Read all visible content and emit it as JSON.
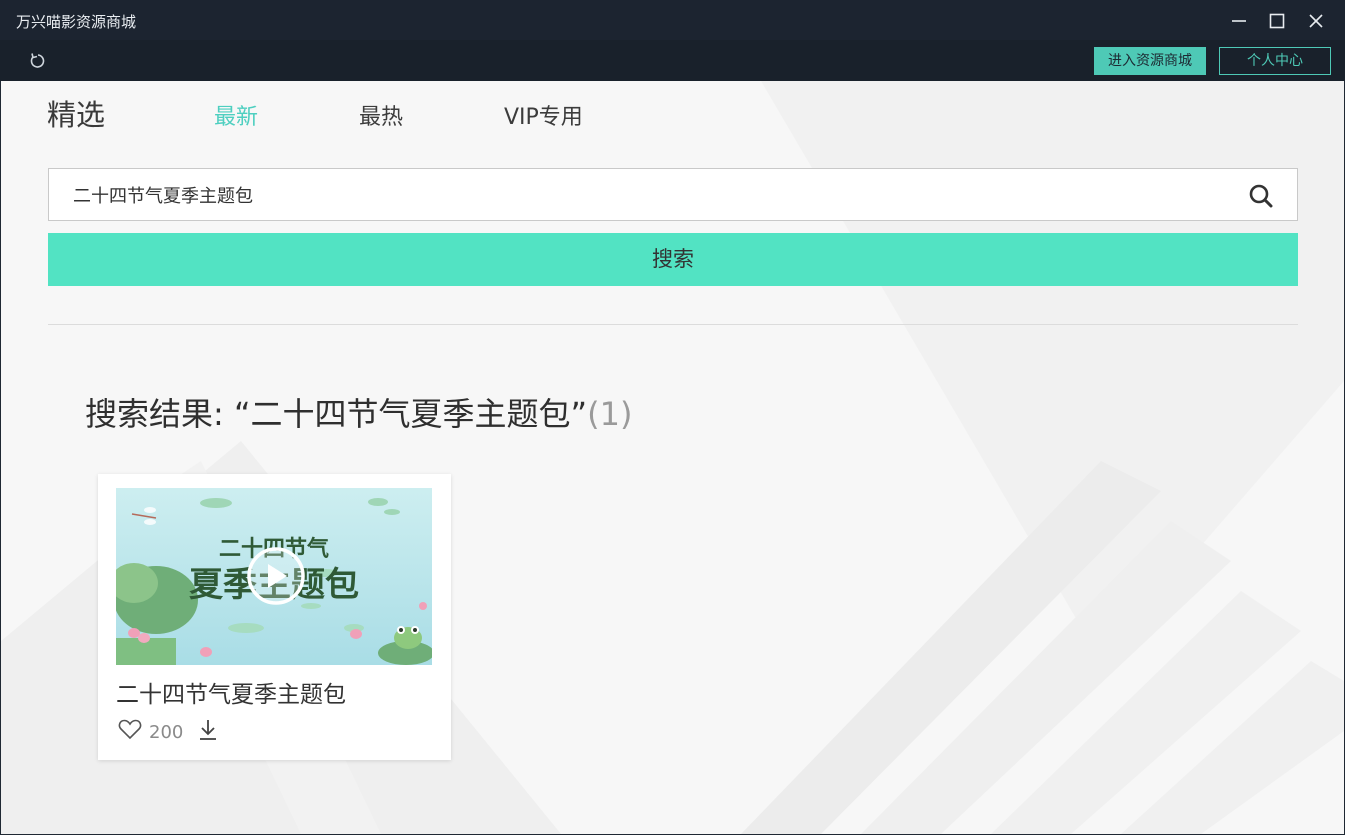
{
  "window": {
    "title": "万兴喵影资源商城"
  },
  "toolbar": {
    "store_label": "进入资源商城",
    "user_label": "个人中心"
  },
  "nav": {
    "section_title": "精选",
    "tabs": [
      {
        "label": "最新",
        "active": true
      },
      {
        "label": "最热",
        "active": false
      },
      {
        "label": "VIP专用",
        "active": false
      }
    ]
  },
  "search": {
    "value": "二十四节气夏季主题包",
    "button_label": "搜索"
  },
  "results": {
    "prefix": "搜索结果: ",
    "query_quoted": "“二十四节气夏季主题包”",
    "count": "(1)",
    "items": [
      {
        "title": "二十四节气夏季主题包",
        "likes": "200",
        "thumbnail_text_line1": "二十四节气",
        "thumbnail_text_line2": "夏季主题包"
      }
    ]
  },
  "colors": {
    "accent": "#52e3c3",
    "active_tab": "#4ecfc0",
    "titlebar": "#1c2430"
  }
}
